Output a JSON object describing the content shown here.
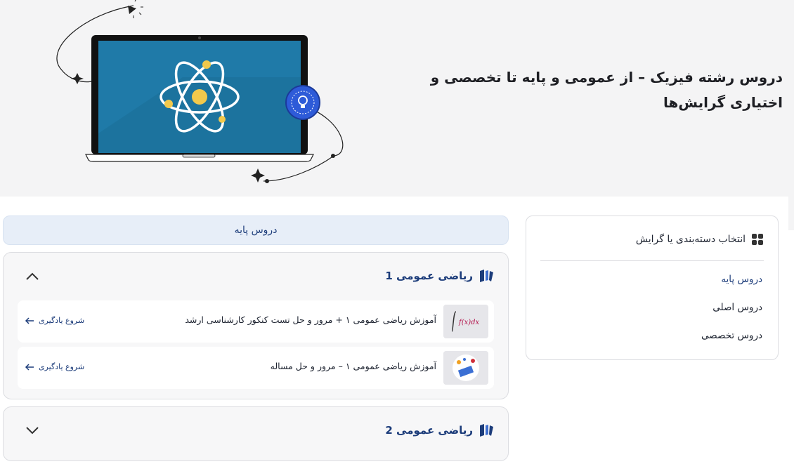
{
  "hero": {
    "title": "دروس رشته فیزیک – از عمومی و پایه تا تخصصی و اختیاری گرایش‌ها"
  },
  "tab": {
    "label": "دروس پایه"
  },
  "accordions": [
    {
      "title": "ریاضی عمومی 1",
      "expanded": true,
      "items": [
        {
          "title": "آموزش ریاضی عمومی ۱ + مرور و حل تست کنکور کارشناسی ارشد",
          "link": "شروع یادگیری",
          "thumb_icon": "integral-formula-thumbnail"
        },
        {
          "title": "آموزش ریاضی عمومی ۱ – مرور و حل مساله",
          "link": "شروع یادگیری",
          "thumb_icon": "math-illustration-thumbnail"
        }
      ]
    },
    {
      "title": "ریاضی عمومی 2",
      "expanded": false,
      "items": []
    }
  ],
  "sidebar": {
    "heading": "انتخاب دسته‌بندی یا گرایش",
    "items": [
      {
        "label": "دروس پایه",
        "active": true
      },
      {
        "label": "دروس اصلی",
        "active": false
      },
      {
        "label": "دروس تخصصی",
        "active": false
      }
    ]
  },
  "colors": {
    "accent": "#1c3c7a",
    "hero_bg": "#f4f4f5",
    "tab_bg": "#e7eef8",
    "screen": "#1f7aa8"
  }
}
